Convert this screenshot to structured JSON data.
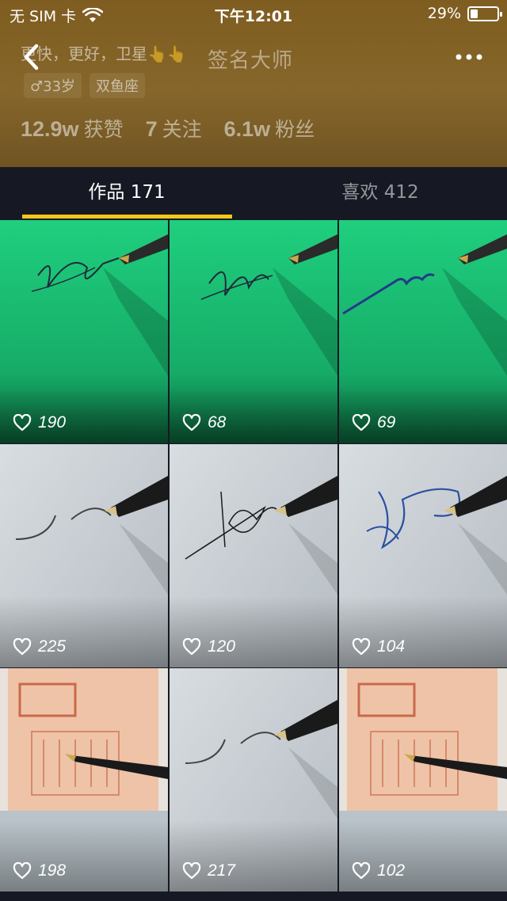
{
  "status_bar": {
    "carrier": "无 SIM 卡",
    "time": "下午12:01",
    "battery_percent": "29%",
    "battery_level": 0.29
  },
  "profile": {
    "signature": "更快，更好，卫星👆👆",
    "nickname": "签名大师",
    "tags": [
      "♂33岁",
      "双鱼座"
    ],
    "stats": [
      {
        "value": "12.9w",
        "label": "获赞"
      },
      {
        "value": "7",
        "label": "关注"
      },
      {
        "value": "6.1w",
        "label": "粉丝"
      }
    ]
  },
  "tabs": [
    {
      "label": "作品 171",
      "active": true
    },
    {
      "label": "喜欢 412",
      "active": false
    }
  ],
  "videos": [
    {
      "likes": "190",
      "theme": "green"
    },
    {
      "likes": "68",
      "theme": "green"
    },
    {
      "likes": "69",
      "theme": "green"
    },
    {
      "likes": "225",
      "theme": "paper"
    },
    {
      "likes": "120",
      "theme": "paper"
    },
    {
      "likes": "104",
      "theme": "paper"
    },
    {
      "likes": "198",
      "theme": "banknote"
    },
    {
      "likes": "217",
      "theme": "paper"
    },
    {
      "likes": "102",
      "theme": "banknote"
    }
  ],
  "colors": {
    "accent": "#f5c71a",
    "background": "#161823",
    "header": "#86662a"
  }
}
